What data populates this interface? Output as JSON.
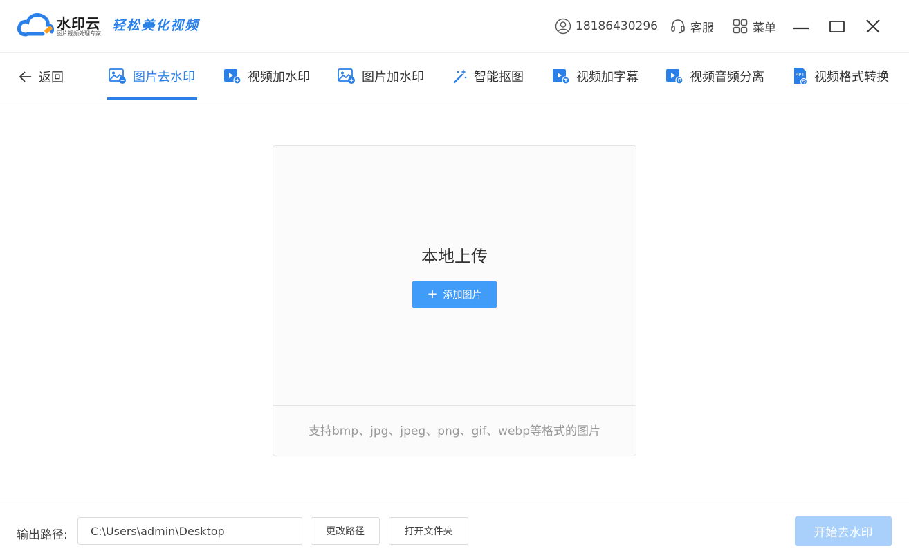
{
  "app": {
    "name": "水印云",
    "subtitle": "图片视频处理专家",
    "slogan": "轻松美化视频"
  },
  "header": {
    "phone": "18186430296",
    "service_label": "客服",
    "menu_label": "菜单"
  },
  "nav": {
    "back_label": "返回",
    "tabs": [
      {
        "label": "图片去水印",
        "icon": "image-remove-icon",
        "active": true
      },
      {
        "label": "视频加水印",
        "icon": "video-add-icon",
        "active": false
      },
      {
        "label": "图片加水印",
        "icon": "image-add-icon",
        "active": false
      },
      {
        "label": "智能抠图",
        "icon": "magic-wand-icon",
        "active": false
      },
      {
        "label": "视频加字幕",
        "icon": "video-subtitle-icon",
        "active": false
      },
      {
        "label": "视频音频分离",
        "icon": "video-audio-icon",
        "active": false
      },
      {
        "label": "视频格式转换",
        "icon": "mp4-convert-icon",
        "active": false
      }
    ]
  },
  "upload": {
    "title": "本地上传",
    "add_button_label": "添加图片",
    "formats_hint": "支持bmp、jpg、jpeg、png、gif、webp等格式的图片"
  },
  "footer": {
    "output_label": "输出路径:",
    "output_path": "C:\\Users\\admin\\Desktop",
    "change_path_label": "更改路径",
    "open_folder_label": "打开文件夹",
    "start_label": "开始去水印"
  },
  "colors": {
    "accent": "#2b7fe8",
    "button_blue": "#419bf9",
    "disabled_blue": "#a8d0fb",
    "border": "#e4e4e4",
    "hint_text": "#999999"
  }
}
